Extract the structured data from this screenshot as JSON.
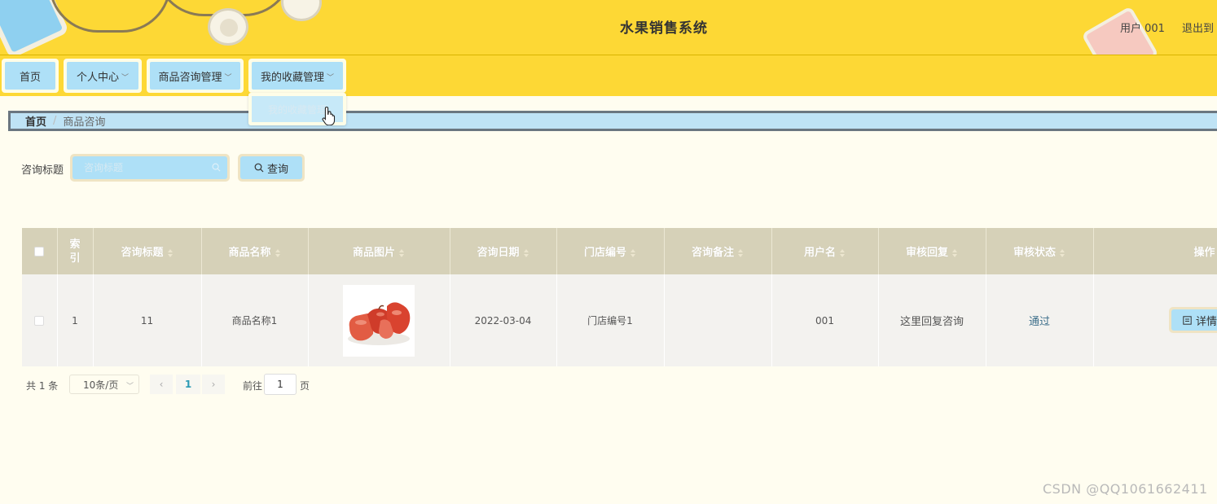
{
  "header": {
    "title": "水果销售系统",
    "user": "用户 001",
    "logout": "退出到"
  },
  "nav": {
    "items": [
      {
        "label": "首页",
        "has_dropdown": false
      },
      {
        "label": "个人中心",
        "has_dropdown": true
      },
      {
        "label": "商品咨询管理",
        "has_dropdown": true
      },
      {
        "label": "我的收藏管理",
        "has_dropdown": true
      }
    ],
    "dropdown": {
      "item": "我的收藏管理"
    }
  },
  "breadcrumb": {
    "home": "首页",
    "separator": "/",
    "current": "商品咨询"
  },
  "search": {
    "label": "咨询标题",
    "placeholder": "咨询标题",
    "button": "查询"
  },
  "table": {
    "columns": [
      "索引",
      "咨询标题",
      "商品名称",
      "商品图片",
      "咨询日期",
      "门店编号",
      "咨询备注",
      "用户名",
      "审核回复",
      "审核状态",
      "操作"
    ],
    "rows": [
      {
        "index": "1",
        "title": "11",
        "product_name": "商品名称1",
        "product_image": "red-fruit-image",
        "date": "2022-03-04",
        "store_no": "门店编号1",
        "remark": "",
        "username": "001",
        "reply": "这里回复咨询",
        "status": "通过",
        "action": "详情"
      }
    ]
  },
  "pagination": {
    "total": "共 1 条",
    "page_size": "10条/页",
    "prev": "‹",
    "current": "1",
    "next": "›",
    "goto_label": "前往",
    "goto_value": "1",
    "page_label": "页"
  },
  "watermark": "CSDN @QQ1061662411",
  "colors": {
    "header_bg": "#fdd835",
    "button_bg": "#aee0f7",
    "table_header": "#d6d1b8",
    "page_bg": "#fffdf0"
  }
}
